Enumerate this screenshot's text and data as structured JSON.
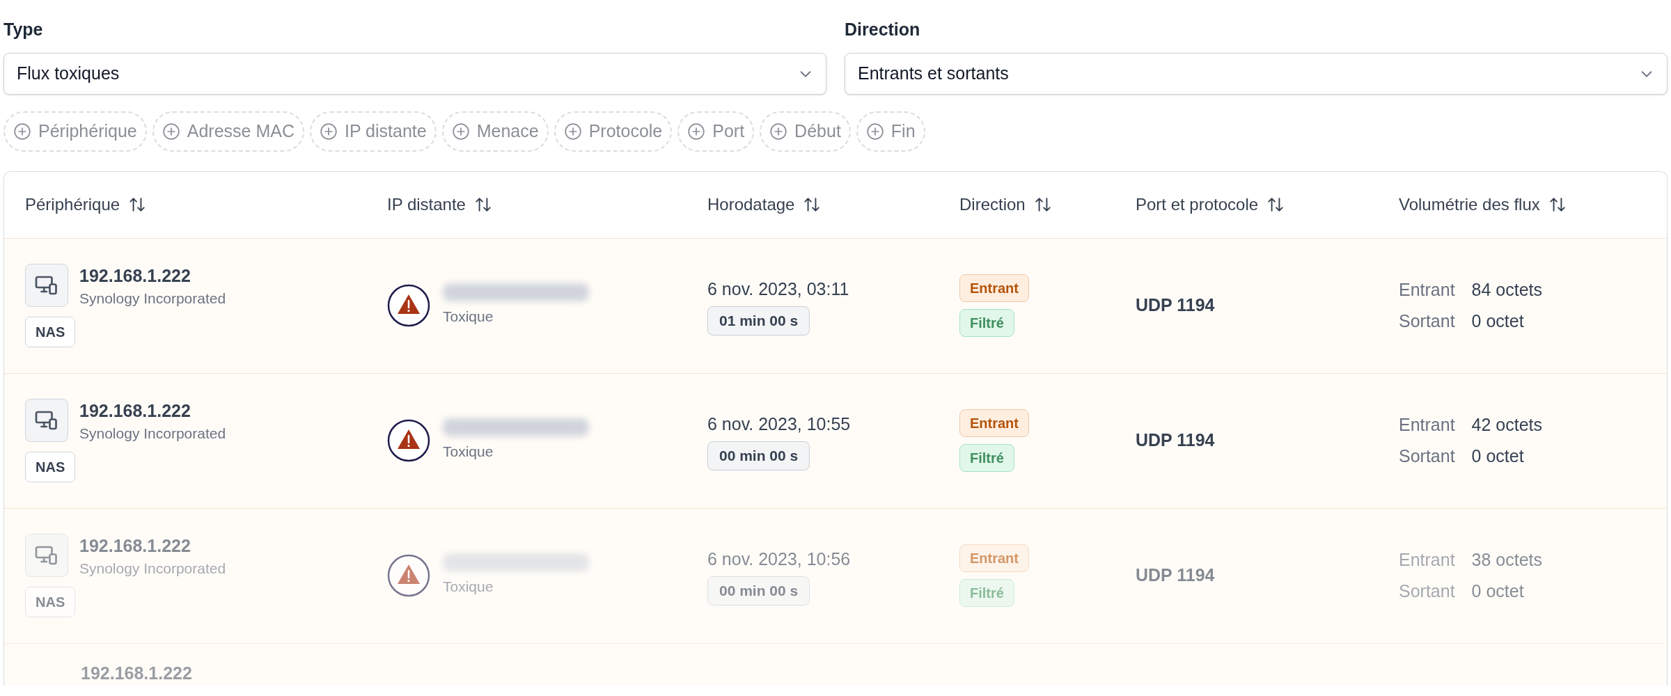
{
  "filters": [
    {
      "label": "Type",
      "value": "Flux toxiques"
    },
    {
      "label": "Direction",
      "value": "Entrants et sortants"
    }
  ],
  "chips": [
    "Périphérique",
    "Adresse MAC",
    "IP distante",
    "Menace",
    "Protocole",
    "Port",
    "Début",
    "Fin"
  ],
  "table": {
    "columns": [
      "Périphérique",
      "IP distante",
      "Horodatage",
      "Direction",
      "Port et protocole",
      "Volumétrie des flux"
    ],
    "rows": [
      {
        "kind": "full",
        "ip": "192.168.1.222",
        "vendor": "Synology Incorporated",
        "tag": "NAS",
        "threat": "Toxique",
        "time": "6 nov. 2023, 03:11",
        "duration": "01 min 00 s",
        "direction": "Entrant",
        "status": "Filtré",
        "port": "UDP 1194",
        "in_label": "Entrant",
        "in_value": "84 octets",
        "out_label": "Sortant",
        "out_value": "0 octet"
      },
      {
        "kind": "full",
        "ip": "192.168.1.222",
        "vendor": "Synology Incorporated",
        "tag": "NAS",
        "threat": "Toxique",
        "time": "6 nov. 2023, 10:55",
        "duration": "00 min 00 s",
        "direction": "Entrant",
        "status": "Filtré",
        "port": "UDP 1194",
        "in_label": "Entrant",
        "in_value": "42 octets",
        "out_label": "Sortant",
        "out_value": "0 octet"
      },
      {
        "kind": "fading",
        "ip": "192.168.1.222",
        "vendor": "Synology Incorporated",
        "tag": "NAS",
        "threat": "Toxique",
        "time": "6 nov. 2023, 10:56",
        "duration": "00 min 00 s",
        "direction": "Entrant",
        "status": "Filtré",
        "port": "UDP 1194",
        "in_label": "Entrant",
        "in_value": "38 octets",
        "out_label": "Sortant",
        "out_value": "0 octet"
      },
      {
        "kind": "faint",
        "ip": "192.168.1.222"
      }
    ]
  }
}
